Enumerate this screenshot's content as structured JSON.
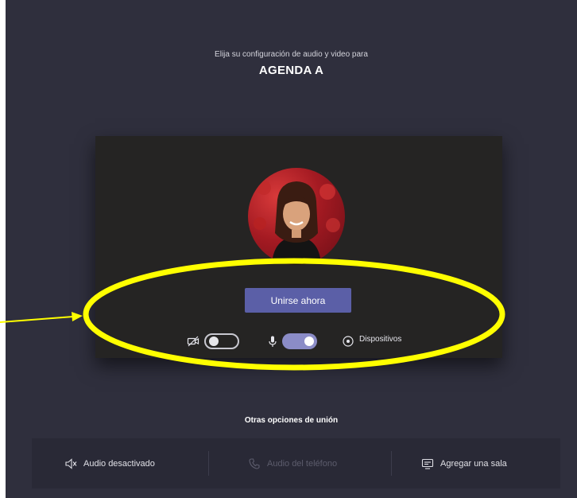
{
  "header": {
    "subtitle": "Elija su configuración de audio y video para",
    "meeting_title": "AGENDA A"
  },
  "preview": {
    "join_button_label": "Unirse ahora",
    "camera_toggle": {
      "icon": "camera-off-icon",
      "state": "off"
    },
    "mic_toggle": {
      "icon": "microphone-icon",
      "state": "on"
    },
    "devices_label": "Dispositivos",
    "devices_icon": "gear-icon"
  },
  "other_options": {
    "title": "Otras opciones de unión",
    "items": [
      {
        "label": "Audio desactivado",
        "icon": "speaker-off-icon",
        "enabled": true
      },
      {
        "label": "Audio del teléfono",
        "icon": "phone-icon",
        "enabled": false
      },
      {
        "label": "Agregar una sala",
        "icon": "cast-room-icon",
        "enabled": true
      }
    ]
  },
  "colors": {
    "background": "#2f2f3d",
    "preview_bg": "#252423",
    "accent": "#5b5fa7",
    "toggle_on": "#8b8cc7",
    "annotation": "#ffff00"
  }
}
